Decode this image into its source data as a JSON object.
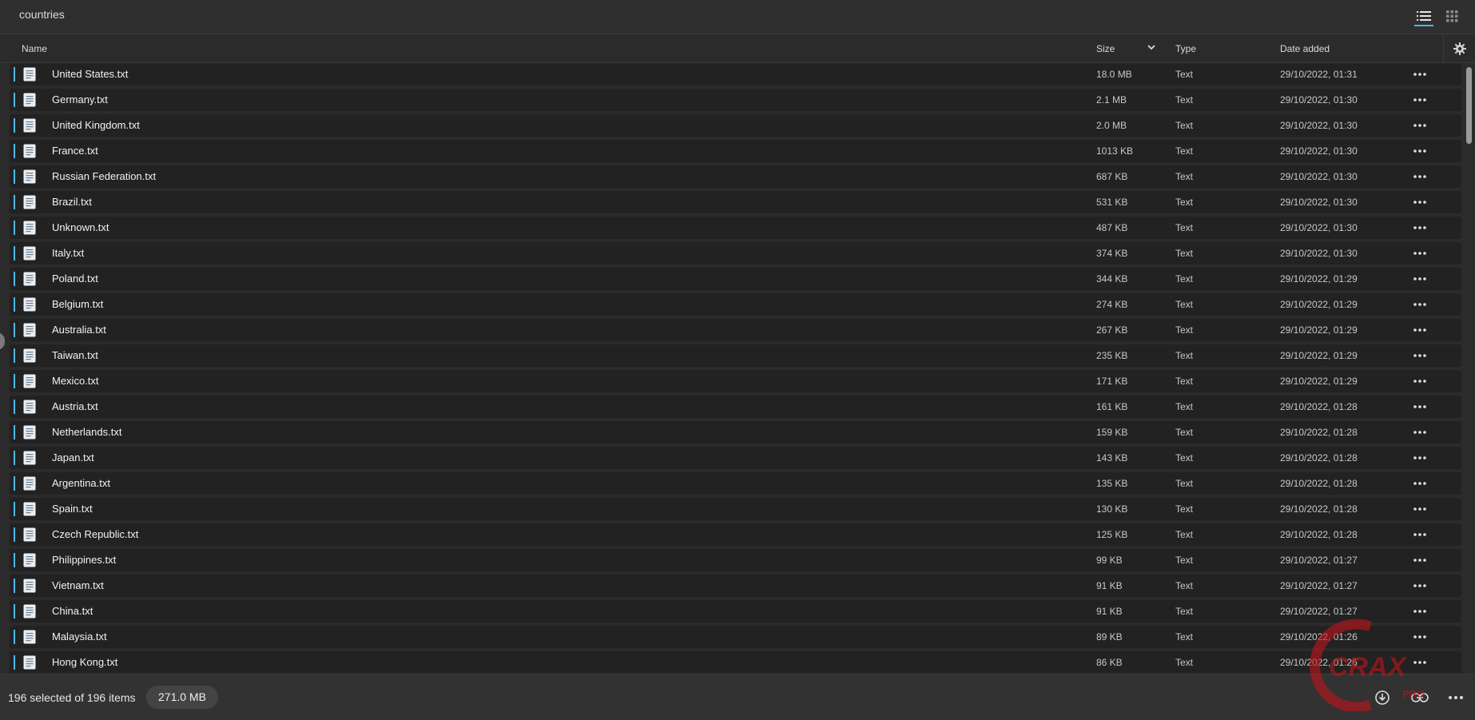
{
  "header": {
    "folder_title": "countries"
  },
  "columns": {
    "name": "Name",
    "size": "Size",
    "type": "Type",
    "date": "Date added"
  },
  "files": [
    {
      "name": "United States.txt",
      "size": "18.0 MB",
      "type": "Text",
      "date": "29/10/2022, 01:31"
    },
    {
      "name": "Germany.txt",
      "size": "2.1 MB",
      "type": "Text",
      "date": "29/10/2022, 01:30"
    },
    {
      "name": "United Kingdom.txt",
      "size": "2.0 MB",
      "type": "Text",
      "date": "29/10/2022, 01:30"
    },
    {
      "name": "France.txt",
      "size": "1013 KB",
      "type": "Text",
      "date": "29/10/2022, 01:30"
    },
    {
      "name": "Russian Federation.txt",
      "size": "687 KB",
      "type": "Text",
      "date": "29/10/2022, 01:30"
    },
    {
      "name": "Brazil.txt",
      "size": "531 KB",
      "type": "Text",
      "date": "29/10/2022, 01:30"
    },
    {
      "name": "Unknown.txt",
      "size": "487 KB",
      "type": "Text",
      "date": "29/10/2022, 01:30"
    },
    {
      "name": "Italy.txt",
      "size": "374 KB",
      "type": "Text",
      "date": "29/10/2022, 01:30"
    },
    {
      "name": "Poland.txt",
      "size": "344 KB",
      "type": "Text",
      "date": "29/10/2022, 01:29"
    },
    {
      "name": "Belgium.txt",
      "size": "274 KB",
      "type": "Text",
      "date": "29/10/2022, 01:29"
    },
    {
      "name": "Australia.txt",
      "size": "267 KB",
      "type": "Text",
      "date": "29/10/2022, 01:29"
    },
    {
      "name": "Taiwan.txt",
      "size": "235 KB",
      "type": "Text",
      "date": "29/10/2022, 01:29"
    },
    {
      "name": "Mexico.txt",
      "size": "171 KB",
      "type": "Text",
      "date": "29/10/2022, 01:29"
    },
    {
      "name": "Austria.txt",
      "size": "161 KB",
      "type": "Text",
      "date": "29/10/2022, 01:28"
    },
    {
      "name": "Netherlands.txt",
      "size": "159 KB",
      "type": "Text",
      "date": "29/10/2022, 01:28"
    },
    {
      "name": "Japan.txt",
      "size": "143 KB",
      "type": "Text",
      "date": "29/10/2022, 01:28"
    },
    {
      "name": "Argentina.txt",
      "size": "135 KB",
      "type": "Text",
      "date": "29/10/2022, 01:28"
    },
    {
      "name": "Spain.txt",
      "size": "130 KB",
      "type": "Text",
      "date": "29/10/2022, 01:28"
    },
    {
      "name": "Czech Republic.txt",
      "size": "125 KB",
      "type": "Text",
      "date": "29/10/2022, 01:28"
    },
    {
      "name": "Philippines.txt",
      "size": "99 KB",
      "type": "Text",
      "date": "29/10/2022, 01:27"
    },
    {
      "name": "Vietnam.txt",
      "size": "91 KB",
      "type": "Text",
      "date": "29/10/2022, 01:27"
    },
    {
      "name": "China.txt",
      "size": "91 KB",
      "type": "Text",
      "date": "29/10/2022, 01:27"
    },
    {
      "name": "Malaysia.txt",
      "size": "89 KB",
      "type": "Text",
      "date": "29/10/2022, 01:26"
    },
    {
      "name": "Hong Kong.txt",
      "size": "86 KB",
      "type": "Text",
      "date": "29/10/2022, 01:26"
    }
  ],
  "footer": {
    "selection": "196 selected of 196 items",
    "total_size": "271.0 MB"
  },
  "watermark": {
    "text": "CRAX",
    "subtext": "PRO"
  },
  "colors": {
    "accent": "#4fb7e8",
    "background": "#2b2b2b",
    "row": "#222222",
    "watermark": "#c0141b"
  },
  "icons": [
    "list-view-icon",
    "grid-view-icon",
    "chevron-down-icon",
    "gear-icon",
    "text-file-icon",
    "more-icon",
    "download-icon",
    "link-icon"
  ]
}
